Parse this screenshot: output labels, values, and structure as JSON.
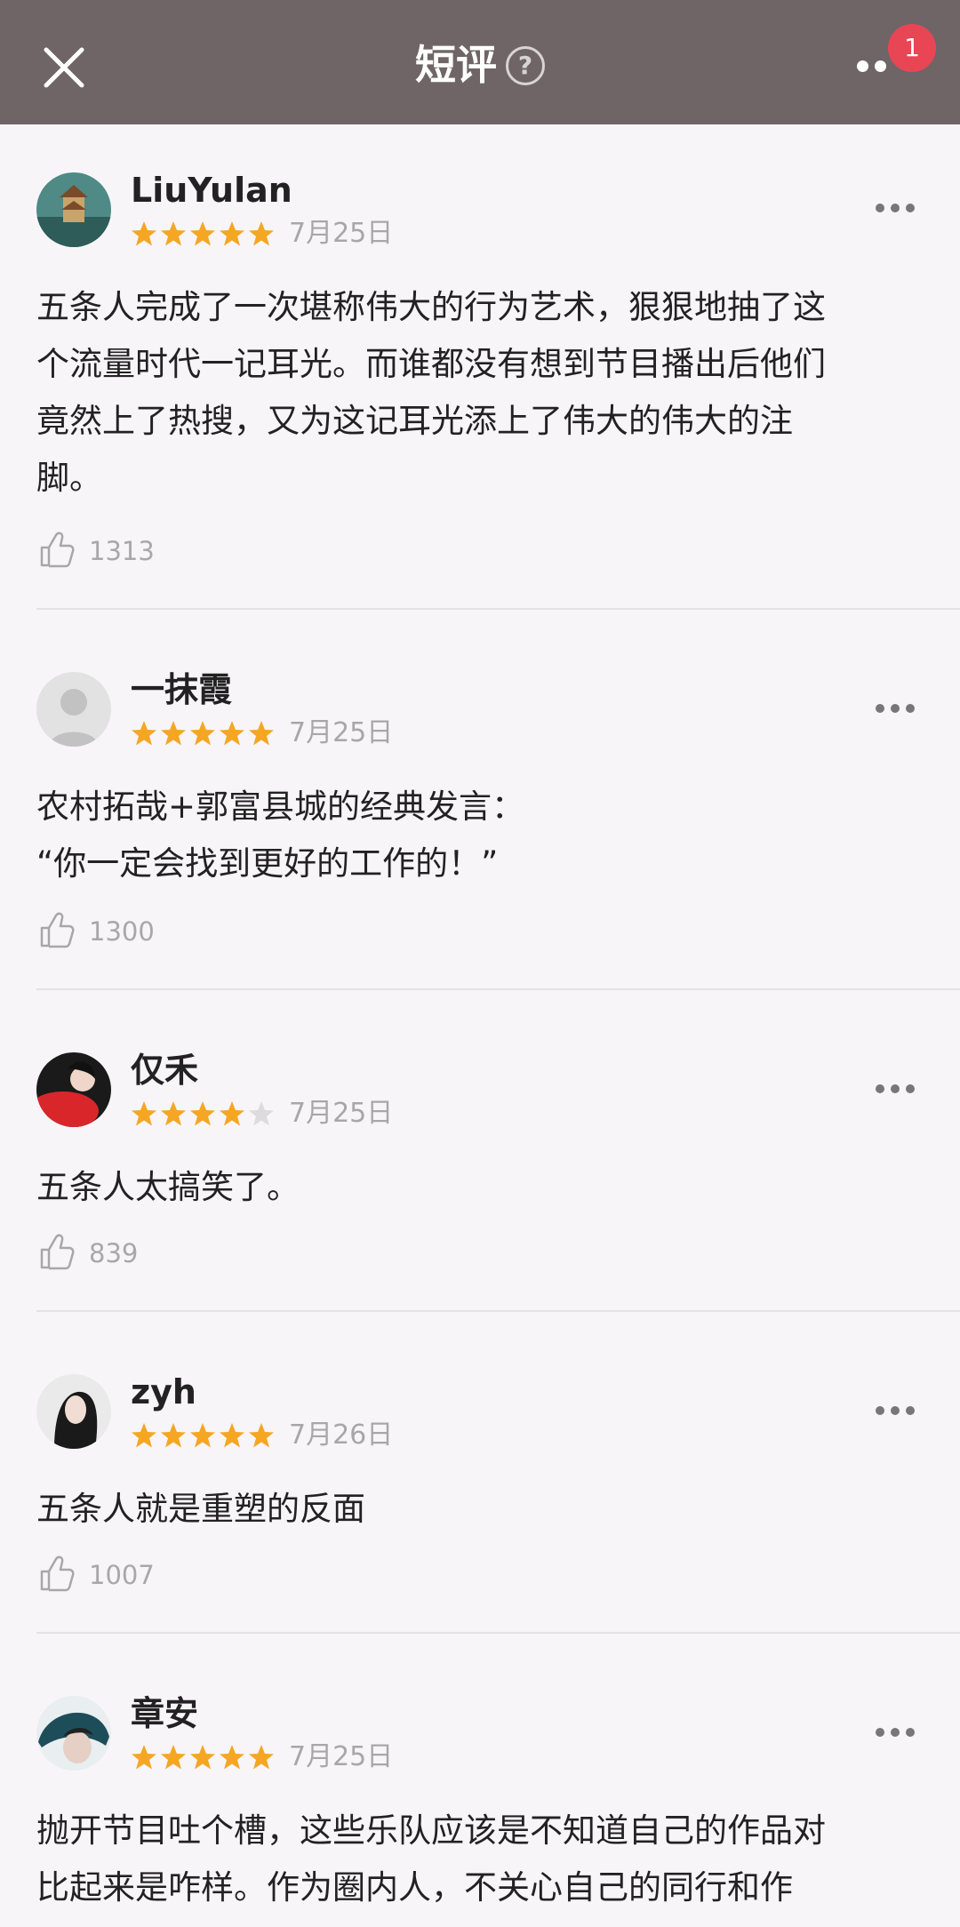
{
  "header": {
    "title": "短评",
    "help_icon": "question-circle-icon",
    "close_icon": "close-icon",
    "more_icon": "more-dots-icon",
    "badge_count": "1"
  },
  "colors": {
    "header_bg": "#6f6566",
    "star_filled": "#f5a623",
    "star_empty": "#dcdcdc",
    "badge": "#e84654"
  },
  "comments": [
    {
      "username": "LiuYulan",
      "rating": 5,
      "date": "7月25日",
      "text": "五条人完成了一次堪称伟大的行为艺术，狠狠地抽了这\n个流量时代一记耳光。而谁都没有想到节目播出后他们\n竟然上了热搜，又为这记耳光添上了伟大的伟大的注\n脚。",
      "likes": "1313"
    },
    {
      "username": "一抹霞",
      "rating": 5,
      "date": "7月25日",
      "text": "农村拓哉+郭富县城的经典发言：\n“你一定会找到更好的工作的！”",
      "likes": "1300"
    },
    {
      "username": "仅禾",
      "rating": 4,
      "date": "7月25日",
      "text": "五条人太搞笑了。",
      "likes": "839"
    },
    {
      "username": "zyh",
      "rating": 5,
      "date": "7月26日",
      "text": "五条人就是重塑的反面",
      "likes": "1007"
    },
    {
      "username": "章安",
      "rating": 5,
      "date": "7月25日",
      "text": "抛开节目吐个槽，这些乐队应该是不知道自己的作品对\n比起来是咋样。作为圈内人，不关心自己的同行和作",
      "likes": ""
    }
  ]
}
